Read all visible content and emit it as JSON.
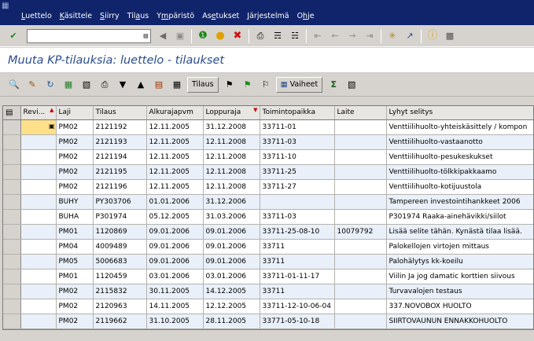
{
  "menu": [
    {
      "pre": "",
      "u": "L",
      "post": "uettelo"
    },
    {
      "pre": "",
      "u": "K",
      "post": "äsittele"
    },
    {
      "pre": "",
      "u": "S",
      "post": "iirry"
    },
    {
      "pre": "Til",
      "u": "a",
      "post": "us"
    },
    {
      "pre": "Y",
      "u": "m",
      "post": "päristö"
    },
    {
      "pre": "As",
      "u": "e",
      "post": "tukset"
    },
    {
      "pre": "",
      "u": "J",
      "post": "ärjestelmä"
    },
    {
      "pre": "O",
      "u": "h",
      "post": "je"
    }
  ],
  "command_field": {
    "value": ""
  },
  "title": "Muuta KP-tilauksia: luettelo - tilaukset",
  "app_toolbar": {
    "order_button": "Tilaus",
    "phases_button": "Vaiheet"
  },
  "table": {
    "columns": [
      "Revi...",
      "Laji",
      "Tilaus",
      "Alkurajapvm",
      "Loppuraja",
      "Toimintopaikka",
      "Laite",
      "Lyhyt selitys"
    ],
    "rows": [
      [
        "",
        "PM02",
        "2121192",
        "12.11.2005",
        "31.12.2008",
        "33711-01",
        "",
        "Venttiilihuolto-yhteiskäsittely / kompon"
      ],
      [
        "",
        "PM02",
        "2121193",
        "12.11.2005",
        "12.11.2008",
        "33711-03",
        "",
        "Venttiilihuolto-vastaanotto"
      ],
      [
        "",
        "PM02",
        "2121194",
        "12.11.2005",
        "12.11.2008",
        "33711-10",
        "",
        "Venttiilihuolto-pesukeskukset"
      ],
      [
        "",
        "PM02",
        "2121195",
        "12.11.2005",
        "12.11.2008",
        "33711-25",
        "",
        "Venttiilihuolto-tölkkipakkaamo"
      ],
      [
        "",
        "PM02",
        "2121196",
        "12.11.2005",
        "12.11.2008",
        "33711-27",
        "",
        "Venttiilihuolto-kotijuustola"
      ],
      [
        "",
        "BUHY",
        "PY303706",
        "01.01.2006",
        "31.12.2006",
        "",
        "",
        "Tampereen investointihankkeet 2006"
      ],
      [
        "",
        "BUHA",
        "P301974",
        "05.12.2005",
        "31.03.2006",
        "33711-03",
        "",
        "P301974 Raaka-ainehävikki/siilot"
      ],
      [
        "",
        "PM01",
        "1120869",
        "09.01.2006",
        "09.01.2006",
        "33711-25-08-10",
        "10079792",
        "Lisää selite tähän. Kynästä tilaa lisää."
      ],
      [
        "",
        "PM04",
        "4009489",
        "09.01.2006",
        "09.01.2006",
        "33711",
        "",
        "Palokellojen virtojen mittaus"
      ],
      [
        "",
        "PM05",
        "5006683",
        "09.01.2006",
        "09.01.2006",
        "33711",
        "",
        "Palohälytys kk-koeilu"
      ],
      [
        "",
        "PM01",
        "1120459",
        "03.01.2006",
        "03.01.2006",
        "33711-01-11-17",
        "",
        "Viilin Ja jog damatic korttien siivous"
      ],
      [
        "",
        "PM02",
        "2115832",
        "30.11.2005",
        "14.12.2005",
        "33711",
        "",
        "Turvavalojen testaus"
      ],
      [
        "",
        "PM02",
        "2120963",
        "14.11.2005",
        "12.12.2005",
        "33711-12-10-06-04",
        "",
        "337.NOVOBOX HUOLTO"
      ],
      [
        "",
        "PM02",
        "2119662",
        "31.10.2005",
        "28.11.2005",
        "33771-05-10-18",
        "",
        "SIIRTOVAUNUN ENNAKKOHUOLTO"
      ]
    ]
  },
  "icons": {
    "enter": "check-icon",
    "save": "save-icon",
    "back": "back-icon",
    "exit": "exit-icon",
    "cancel": "cancel-icon",
    "print": "print-icon",
    "find": "find-icon",
    "find_next": "find-next-icon",
    "first_page": "first-page-icon",
    "prev_page": "prev-page-icon",
    "next_page": "next-page-icon",
    "last_page": "last-page-icon",
    "new_session": "new-session-icon",
    "shortcut": "shortcut-icon",
    "help": "help-icon",
    "layout": "layout-icon"
  },
  "colors": {
    "menubar": "#10246b",
    "title": "#2a4d8c",
    "alt_row": "#e9f0f9",
    "focus_cell": "#ffe08a",
    "sort_marker": "#cc0000"
  }
}
